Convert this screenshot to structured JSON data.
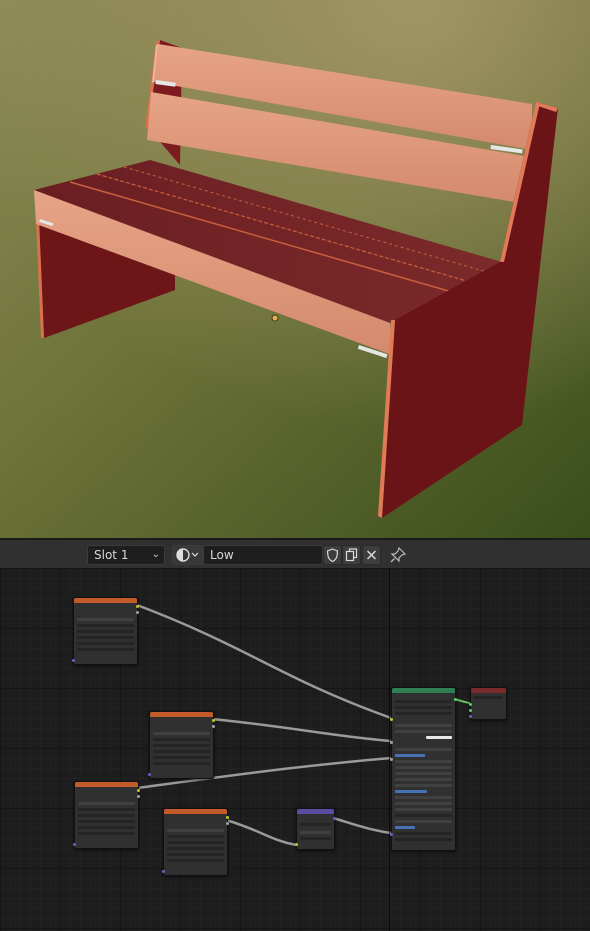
{
  "colors": {
    "header_bg": "#303030",
    "editor_bg": "#1d1d1d",
    "image_node_header": "#c35a2a",
    "principled_header": "#2f7f55",
    "output_header": "#7a2a2a",
    "normal_map_header": "#5a4aa0"
  },
  "header": {
    "slot_label": "Slot 1",
    "material_name": "Low",
    "icons": {
      "slot_chevron": "chevron-down-icon",
      "material_browse": "material-sphere-icon",
      "fake_user": "shield-icon",
      "duplicate": "duplicate-icon",
      "unlink": "close-icon",
      "pin": "pin-icon"
    }
  }
}
